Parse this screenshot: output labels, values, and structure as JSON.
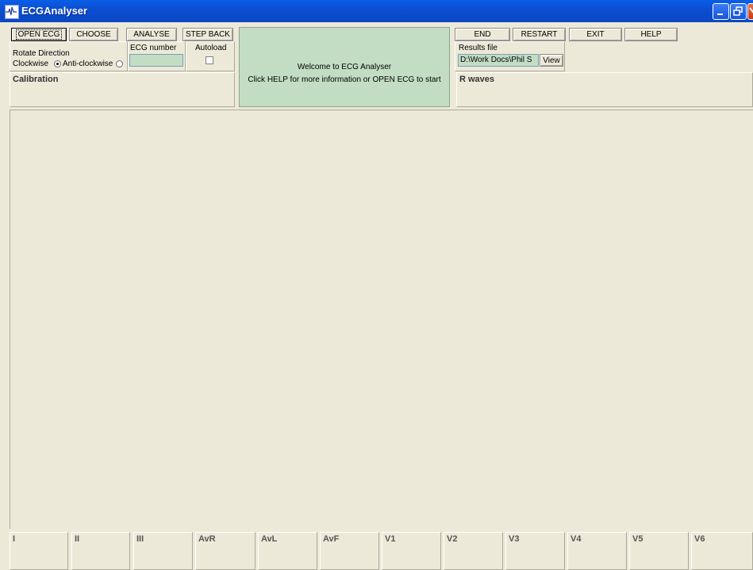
{
  "window": {
    "title": "ECGAnalyser",
    "titlebar_color": "#0a4fd0",
    "close_color": "#c33b12"
  },
  "toolbar_left": {
    "open_ecg": "OPEN ECG",
    "choose": "CHOOSE",
    "analyse": "ANALYSE",
    "step_back": "STEP BACK"
  },
  "rotate": {
    "label": "Rotate Direction",
    "clockwise": "Clockwise",
    "anticlockwise": "Anti-clockwise",
    "selected": "Clockwise"
  },
  "ecg_number": {
    "label": "ECG number",
    "value": ""
  },
  "autoload": {
    "label": "Autoload",
    "checked": false
  },
  "calibration": {
    "title": "Calibration"
  },
  "welcome": {
    "line1": "Welcome to ECG Analyser",
    "line2": "Click HELP for more information or OPEN ECG to start",
    "bg_color": "#c2ddc3"
  },
  "toolbar_right": {
    "end": "END",
    "restart": "RESTART",
    "exit": "EXIT",
    "help": "HELP"
  },
  "results": {
    "label": "Results file",
    "path": "D:\\Work Docs\\Phil S",
    "view": "View"
  },
  "rwaves": {
    "title": "R waves"
  },
  "leads": [
    "I",
    "II",
    "III",
    "AvR",
    "AvL",
    "AvF",
    "V1",
    "V2",
    "V3",
    "V4",
    "V5",
    "V6"
  ]
}
